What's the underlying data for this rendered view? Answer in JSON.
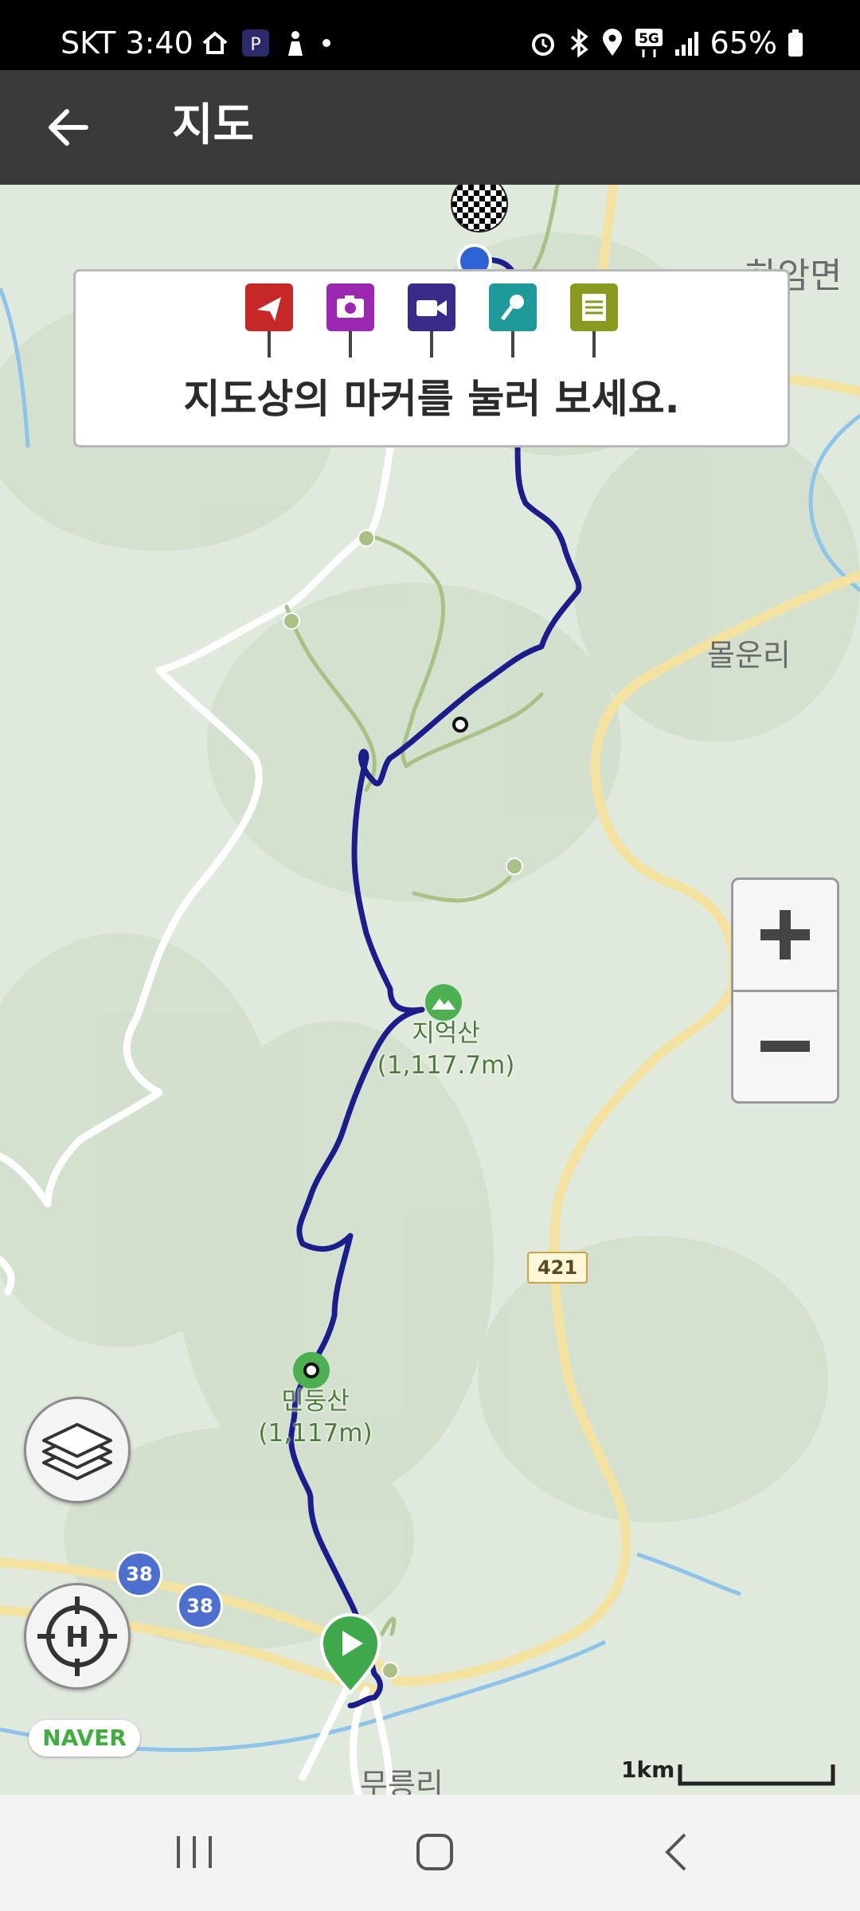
{
  "status_bar": {
    "carrier": "SKT",
    "time": "3:40",
    "network": "5G",
    "battery": "65%"
  },
  "app_bar": {
    "title": "지도"
  },
  "hint": {
    "text": "지도상의 마커를 눌러 보세요.",
    "markers": [
      {
        "icon": "direction-marker-icon",
        "color": "#c62828"
      },
      {
        "icon": "camera-marker-icon",
        "color": "#9c27b0"
      },
      {
        "icon": "video-marker-icon",
        "color": "#3b2a8a"
      },
      {
        "icon": "microphone-marker-icon",
        "color": "#1f9a9a"
      },
      {
        "icon": "memo-marker-icon",
        "color": "#8a9a1e"
      }
    ]
  },
  "map": {
    "places": {
      "top_right": "하암면",
      "right": "몰운리",
      "bottom": "무릉리"
    },
    "peaks": {
      "jieoksan_name": "지억산",
      "jieoksan_height": "(1,117.7m)",
      "mindungsan_name": "민둥산",
      "mindungsan_height": "(1,117m)"
    },
    "road_numbers": {
      "local": "421",
      "national_a": "38",
      "national_b": "38"
    },
    "route_color": "#1c1c8c",
    "attribution": "NAVER",
    "scale": "1km"
  },
  "controls": {
    "zoom_in": "+",
    "zoom_out": "−"
  }
}
